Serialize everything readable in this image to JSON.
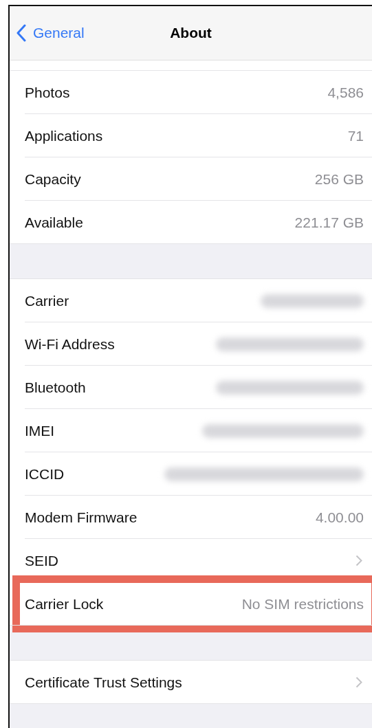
{
  "nav": {
    "back": "General",
    "title": "About"
  },
  "groups": [
    {
      "rows": [
        {
          "kind": "value",
          "label": "Photos",
          "value": "4,586"
        },
        {
          "kind": "value",
          "label": "Applications",
          "value": "71"
        },
        {
          "kind": "value",
          "label": "Capacity",
          "value": "256 GB"
        },
        {
          "kind": "value",
          "label": "Available",
          "value": "221.17 GB"
        }
      ]
    },
    {
      "rows": [
        {
          "kind": "blurred",
          "label": "Carrier"
        },
        {
          "kind": "blurred",
          "label": "Wi-Fi Address"
        },
        {
          "kind": "blurred",
          "label": "Bluetooth"
        },
        {
          "kind": "blurred",
          "label": "IMEI"
        },
        {
          "kind": "blurred",
          "label": "ICCID"
        },
        {
          "kind": "value",
          "label": "Modem Firmware",
          "value": "4.00.00"
        },
        {
          "kind": "chevron",
          "label": "SEID"
        },
        {
          "kind": "value",
          "label": "Carrier Lock",
          "value": "No SIM restrictions",
          "highlighted": true
        }
      ]
    },
    {
      "rows": [
        {
          "kind": "chevron",
          "label": "Certificate Trust Settings"
        }
      ]
    }
  ]
}
